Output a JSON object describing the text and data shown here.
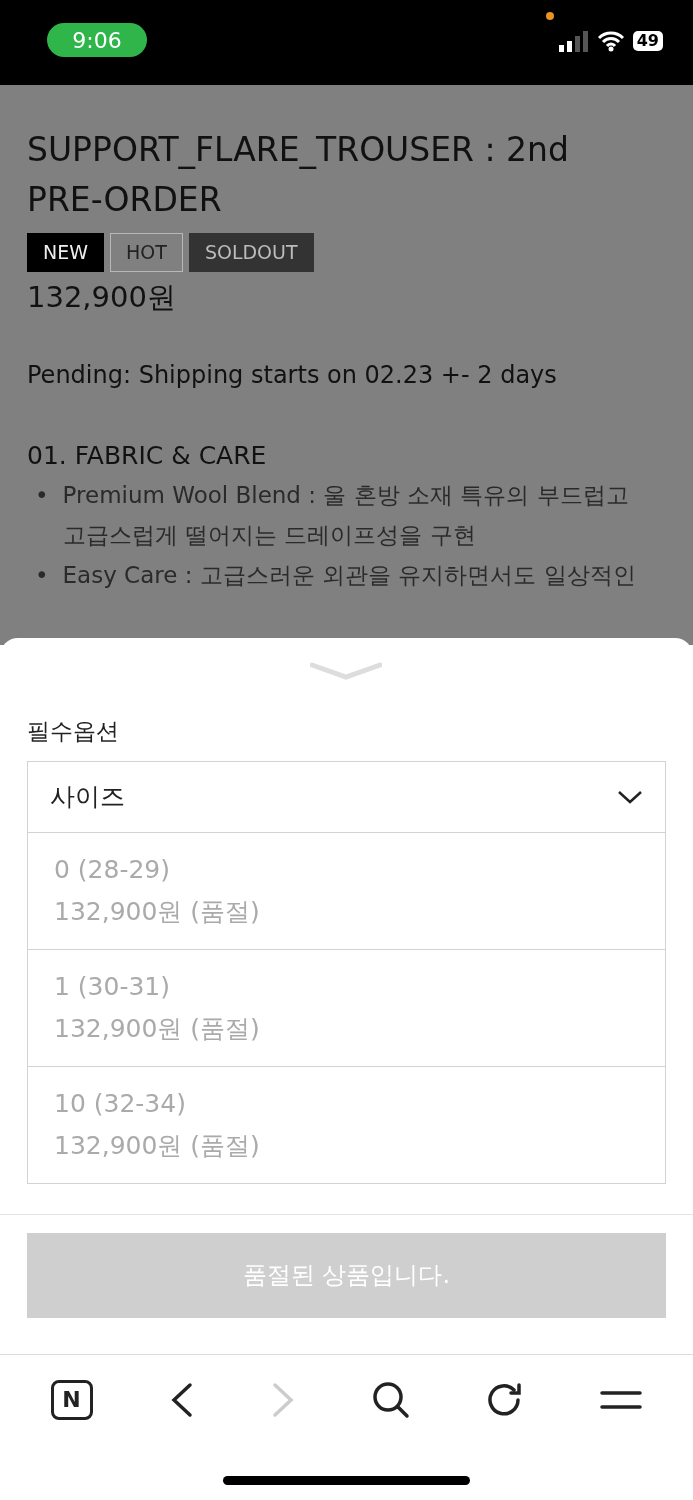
{
  "status_bar": {
    "time": "9:06",
    "battery": "49"
  },
  "product": {
    "title": "SUPPORT_FLARE_TROUSER : 2nd PRE-ORDER",
    "badges": [
      {
        "label": "NEW",
        "kind": "solid"
      },
      {
        "label": "HOT",
        "kind": "outline"
      },
      {
        "label": "SOLDOUT",
        "kind": "dark"
      }
    ],
    "price": "132,900원",
    "notice": "Pending: Shipping starts on 02.23 +- 2 days",
    "section_title": "01. FABRIC & CARE",
    "bullets": [
      {
        "marker": "•",
        "text": "Premium Wool Blend : 울 혼방 소재 특유의 부드럽고 고급스럽게 떨어지는 드레이프성을 구현"
      },
      {
        "marker": "•",
        "text": "Easy Care : 고급스러운 외관을 유지하면서도 일상적인"
      }
    ]
  },
  "option_sheet": {
    "label": "필수옵션",
    "select": {
      "value": "사이즈",
      "expanded": true
    },
    "options": [
      {
        "size": "0 (28-29)",
        "price": "132,900원 (품절)",
        "disabled": true
      },
      {
        "size": "1 (30-31)",
        "price": "132,900원 (품절)",
        "disabled": true
      },
      {
        "size": "10 (32-34)",
        "price": "132,900원 (품절)",
        "disabled": true
      }
    ],
    "button": {
      "label": "품절된 상품입니다.",
      "disabled": true
    }
  },
  "browser_toolbar": {
    "logo": "N",
    "forward_disabled": true
  }
}
